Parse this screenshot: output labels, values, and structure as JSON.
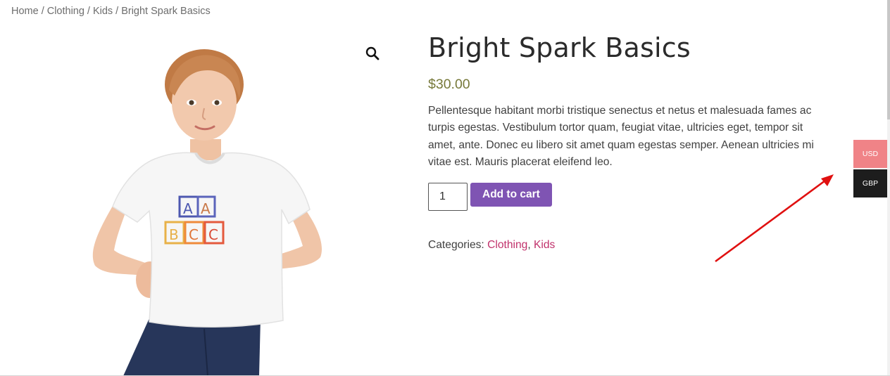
{
  "breadcrumb": {
    "items": [
      "Home",
      "Clothing",
      "Kids"
    ],
    "current": "Bright Spark Basics",
    "separator": "/"
  },
  "product": {
    "title": "Bright Spark Basics",
    "price": "$30.00",
    "description": "Pellentesque habitant morbi tristique senectus et netus et malesuada fames ac turpis egestas. Vestibulum tortor quam, feugiat vitae, ultricies eget, tempor sit amet, ante. Donec eu libero sit amet quam egestas semper. Aenean ultricies mi vitae est. Mauris placerat eleifend leo.",
    "quantity": "1",
    "add_to_cart_label": "Add to cart",
    "categories_label": "Categories:",
    "categories": [
      "Clothing",
      "Kids"
    ],
    "category_separator": ",",
    "image": {
      "shirt_blocks_top": [
        "A",
        "A"
      ],
      "shirt_blocks_bottom": [
        "B",
        "C",
        "C"
      ]
    }
  },
  "zoom": {
    "icon": "magnifier-icon"
  },
  "currency_switcher": {
    "options": [
      "USD",
      "GBP"
    ],
    "selected": "USD"
  },
  "colors": {
    "accent_button": "#7f54b3",
    "price": "#77793a",
    "category_link": "#c1316b",
    "usd_bg": "#f08387",
    "gbp_bg": "#1d1d1d",
    "annotation_arrow": "#e01010"
  }
}
